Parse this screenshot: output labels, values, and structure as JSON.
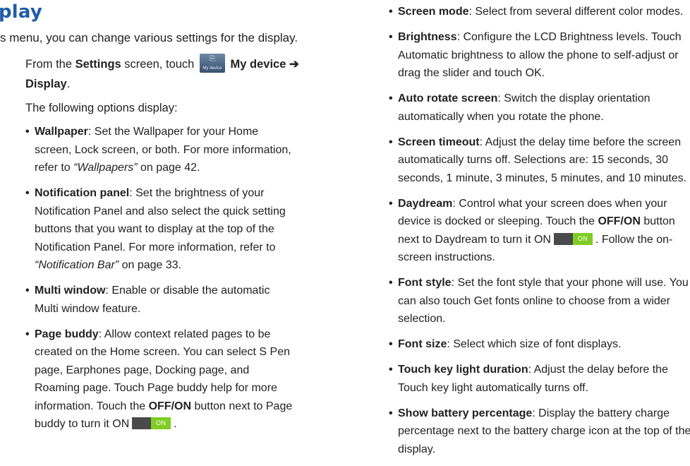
{
  "title": "play",
  "intro": "s menu, you can change various settings for the display.",
  "step1": {
    "pre": "From the ",
    "settings": "Settings",
    "mid": " screen, touch ",
    "icon_caption": "My device",
    "mydevice": "My device ➔",
    "display": "Display",
    "period": "."
  },
  "step2": "The following options display:",
  "col1": [
    {
      "term": "Wallpaper",
      "text": ": Set the Wallpaper for your Home screen, Lock screen, or both. For more information, refer to ",
      "ref": "“Wallpapers”",
      "tail": " on page 42."
    },
    {
      "term": "Notification panel",
      "text": ": Set the brightness of your Notification Panel and also select the quick setting buttons that you want to display at the top of the Notification Panel. For more information, refer to ",
      "ref": "“Notification Bar”",
      "tail": " on page 33."
    },
    {
      "term": "Multi window",
      "text": ": Enable or disable the automatic Multi window feature."
    },
    {
      "term": "Page buddy",
      "text": ": Allow context related pages to be created on the Home screen. You can select S Pen page, Earphones page, Docking page, and Roaming page. Touch Page buddy help for more information. Touch the ",
      "strong": "OFF/ON",
      "tail": " button next to Page buddy to turn it ON",
      "toggle": "ON",
      "end": "."
    }
  ],
  "col2": [
    {
      "term": "Screen mode",
      "text": ": Select from several different color modes."
    },
    {
      "term": "Brightness",
      "text": ": Configure the LCD Brightness levels. Touch Automatic brightness to allow the phone to self-adjust or drag the slider and touch OK."
    },
    {
      "term": "Auto rotate screen",
      "text": ": Switch the display orientation automatically when you rotate the phone."
    },
    {
      "term": "Screen timeout",
      "text": ": Adjust the delay time before the screen automatically turns off. Selections are: 15 seconds, 30 seconds, 1 minute, 3 minutes, 5 minutes, and 10 minutes."
    },
    {
      "term": "Daydream",
      "text": ": Control what your screen does when your device is docked or sleeping. Touch the ",
      "strong": "OFF/ON",
      "tail": " button next to Daydream to turn it ON",
      "toggle": "ON",
      "end": ". Follow the on-screen instructions."
    },
    {
      "term": "Font style",
      "text": ": Set the font style that your phone will use. You can also touch Get fonts online to choose from a wider selection."
    },
    {
      "term": "Font size",
      "text": ": Select which size of font displays."
    },
    {
      "term": "Touch key light duration",
      "text": ": Adjust the delay before the Touch key light automatically turns off."
    },
    {
      "term": "Show battery percentage",
      "text": ": Display the battery charge percentage next to the battery charge icon at the top of the display."
    }
  ],
  "colors": {
    "title": "#1f5ca8",
    "toggle_on": "#7fcc24",
    "toggle_off": "#4a4a4a",
    "icon": "#4a6384"
  }
}
